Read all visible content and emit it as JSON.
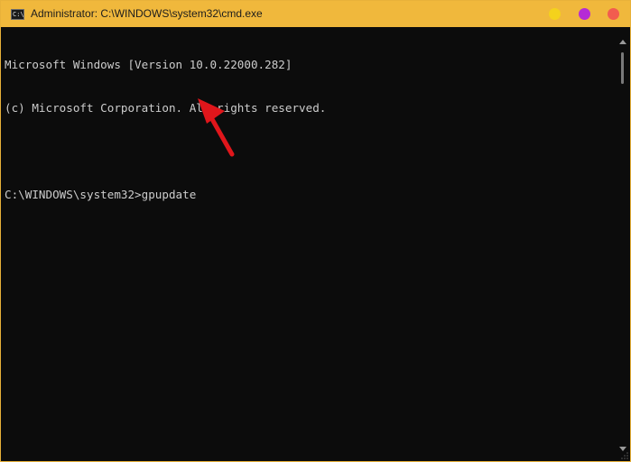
{
  "window": {
    "title": "Administrator: C:\\WINDOWS\\system32\\cmd.exe",
    "icon": "cmd-icon",
    "icon_glyph": "C:\\",
    "controls": {
      "minimize_color": "#f4d21c",
      "maximize_color": "#b52bd6",
      "close_color": "#f25c4f"
    },
    "accent_color": "#f0b83c"
  },
  "console": {
    "lines": [
      "Microsoft Windows [Version 10.0.22000.282]",
      "(c) Microsoft Corporation. All rights reserved.",
      "",
      "C:\\WINDOWS\\system32>gpupdate"
    ],
    "background": "#0c0c0c",
    "text_color": "#cccccc"
  },
  "annotation": {
    "icon": "red-arrow-icon",
    "color": "#e0161b"
  }
}
